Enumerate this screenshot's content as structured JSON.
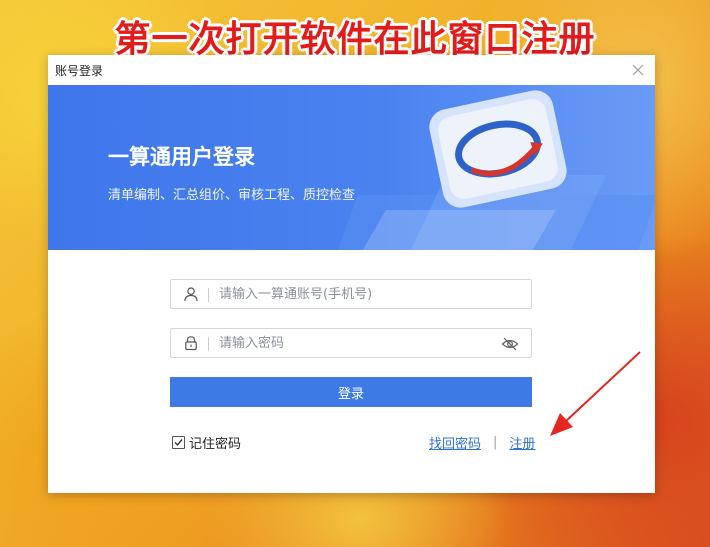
{
  "banner": {
    "text": "第一次打开软件在此窗口注册"
  },
  "window": {
    "title": "账号登录"
  },
  "hero": {
    "title": "一算通用户登录",
    "subtitle": "清单编制、汇总组价、审核工程、质控检查"
  },
  "form": {
    "account": {
      "placeholder": "请输入一算通账号(手机号)",
      "value": ""
    },
    "password": {
      "placeholder": "请输入密码",
      "value": ""
    },
    "login_label": "登录",
    "remember_label": "记住密码",
    "remember_checked": true,
    "forgot_label": "找回密码",
    "separator": "|",
    "register_label": "注册"
  },
  "colors": {
    "accent": "#3d7ae5",
    "link": "#2d6fe0",
    "banner_text": "#e21b1b",
    "arrow": "#e4261f"
  },
  "icons": {
    "close": "close-icon",
    "user": "user-icon",
    "lock": "lock-icon",
    "eye": "eye-off-icon",
    "check": "check-icon",
    "logo": "app-logo-icon"
  }
}
